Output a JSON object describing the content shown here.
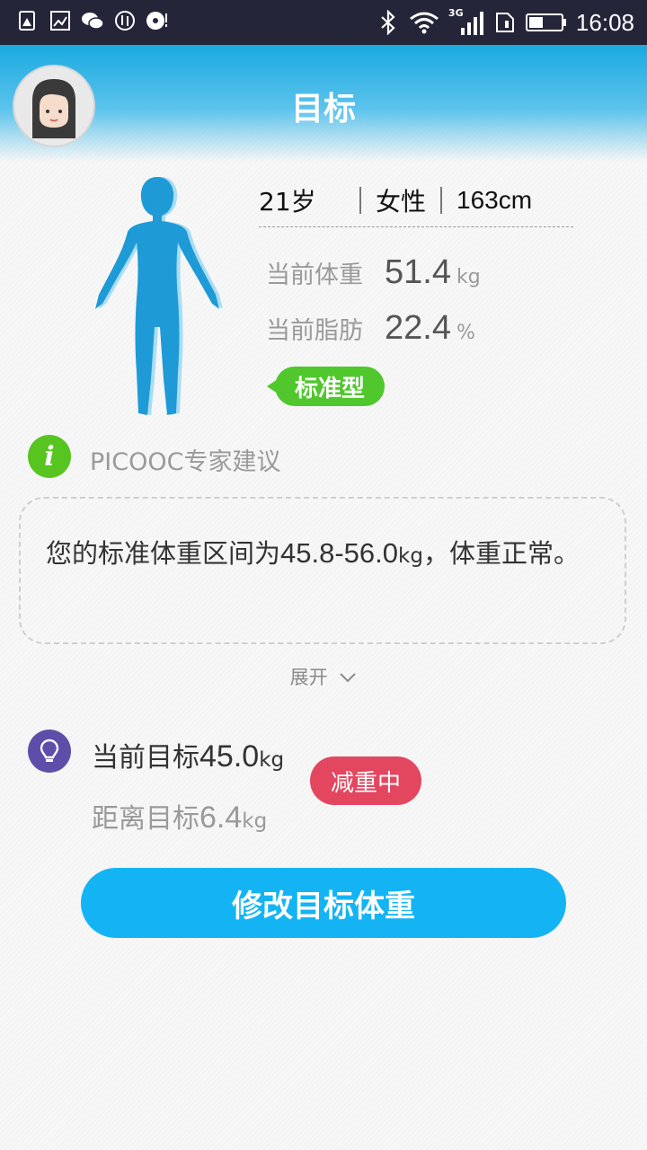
{
  "status_bar": {
    "time": "16:08",
    "network_type": "3G",
    "left_icons": [
      "warning-icon",
      "image-icon",
      "wechat-icon",
      "sync-icon",
      "disc-icon"
    ],
    "right_icons": [
      "bluetooth-icon",
      "wifi-icon",
      "signal-icon",
      "sim-icon",
      "battery-icon"
    ]
  },
  "header": {
    "title": "目标"
  },
  "profile": {
    "age": "21岁",
    "gender": "女性",
    "height": "163cm",
    "weight_label": "当前体重",
    "weight_value": "51.4",
    "weight_unit": "kg",
    "fat_label": "当前脂肪",
    "fat_value": "22.4",
    "fat_unit": "%",
    "body_type": "标准型"
  },
  "advice": {
    "title": "PICOOC专家建议",
    "text_prefix": "您的标准体重区间为",
    "range": "45.8-56.0",
    "unit": "kg",
    "text_suffix": "，体重正常。",
    "expand_label": "展开"
  },
  "goal": {
    "current_label": "当前目标",
    "current_value": "45.0",
    "current_unit": "kg",
    "distance_label": "距离目标",
    "distance_value": "6.4",
    "distance_unit": "kg",
    "status": "减重中"
  },
  "actions": {
    "edit_goal_label": "修改目标体重"
  },
  "colors": {
    "accent": "#14b4f4",
    "tag_green": "#4fc72d",
    "status_red": "#e34760",
    "bulb_purple": "#5e4ea9",
    "figure_blue": "#1e9ad6"
  }
}
